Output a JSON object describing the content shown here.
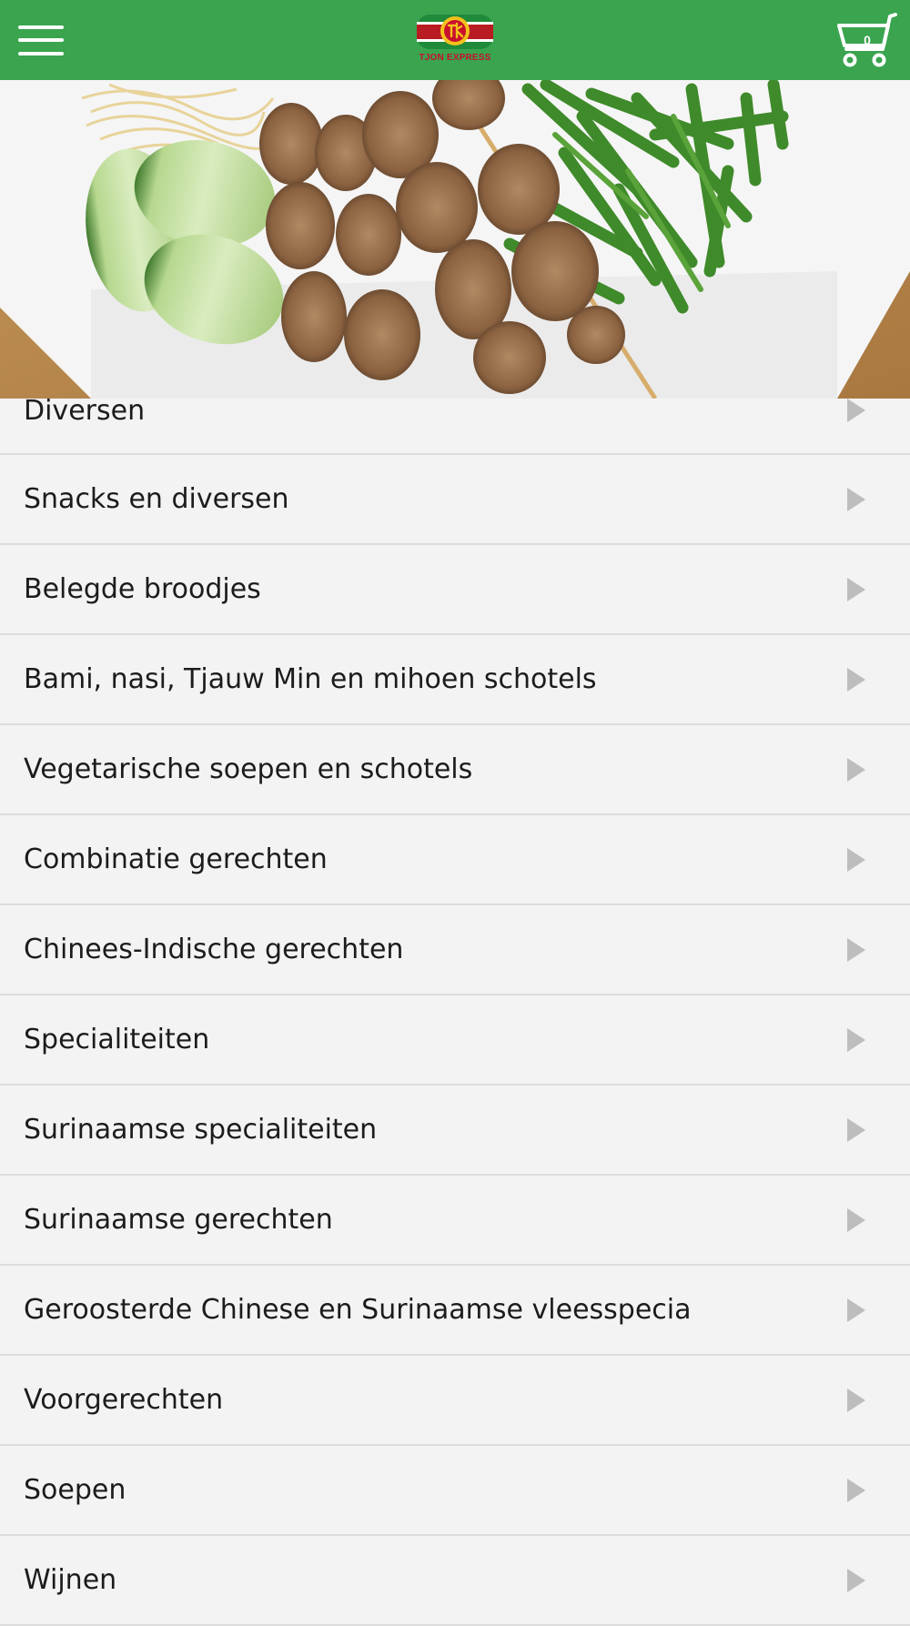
{
  "header": {
    "brand_name": "TJON EXPRESS",
    "cart_count": "0"
  },
  "categories": [
    {
      "label": "Diversen"
    },
    {
      "label": "Snacks en diversen"
    },
    {
      "label": "Belegde broodjes"
    },
    {
      "label": "Bami, nasi, Tjauw Min en mihoen schotels"
    },
    {
      "label": "Vegetarische soepen en schotels"
    },
    {
      "label": "Combinatie gerechten"
    },
    {
      "label": "Chinees-Indische gerechten"
    },
    {
      "label": "Specialiteiten"
    },
    {
      "label": "Surinaamse specialiteiten"
    },
    {
      "label": "Surinaamse gerechten"
    },
    {
      "label": "Geroosterde Chinese en Surinaamse vleesspecia"
    },
    {
      "label": "Voorgerechten"
    },
    {
      "label": "Soepen"
    },
    {
      "label": "Wijnen"
    }
  ],
  "colors": {
    "header_bg": "#3aa44f",
    "list_bg": "#f3f3f3",
    "divider": "#dcdcdc",
    "arrow": "#bdbdbd"
  },
  "icons": {
    "menu": "hamburger-menu-icon",
    "cart": "shopping-cart-icon",
    "arrow": "chevron-right-icon"
  }
}
